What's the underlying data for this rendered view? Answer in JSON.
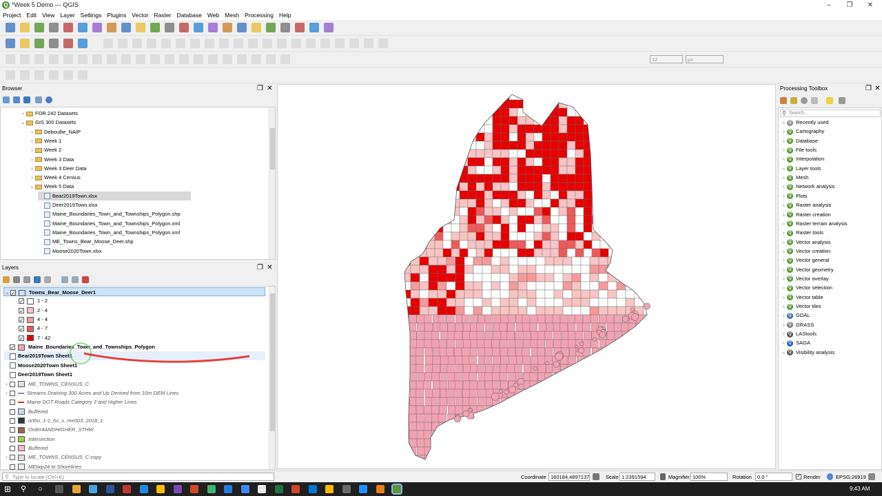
{
  "window": {
    "title": "*Week 5 Demo — QGIS"
  },
  "menu": [
    "Project",
    "Edit",
    "View",
    "Layer",
    "Settings",
    "Plugins",
    "Vector",
    "Raster",
    "Database",
    "Web",
    "Mesh",
    "Processing",
    "Help"
  ],
  "browser": {
    "title": "Browser",
    "items": [
      {
        "label": "FOR 242 Datasets",
        "arrow": "›",
        "indent": 0,
        "type": "folder"
      },
      {
        "label": "GIS 300 Datasets",
        "arrow": "⌄",
        "indent": 0,
        "type": "folder"
      },
      {
        "label": "Deboullie_NAIP",
        "arrow": "›",
        "indent": 1,
        "type": "folder"
      },
      {
        "label": "Week 1",
        "arrow": "›",
        "indent": 1,
        "type": "folder"
      },
      {
        "label": "Week 2",
        "arrow": "›",
        "indent": 1,
        "type": "folder"
      },
      {
        "label": "Week 3 Data",
        "arrow": "›",
        "indent": 1,
        "type": "folder"
      },
      {
        "label": "Week 3 Deer Data",
        "arrow": "›",
        "indent": 1,
        "type": "folder"
      },
      {
        "label": "Week 4 Census",
        "arrow": "›",
        "indent": 1,
        "type": "folder"
      },
      {
        "label": "Week 5 Data",
        "arrow": "⌄",
        "indent": 1,
        "type": "folder"
      },
      {
        "label": "Bear2019Town.xlsx",
        "arrow": "",
        "indent": 2,
        "type": "file",
        "selected": true
      },
      {
        "label": "Deer2019Town.xlsx",
        "arrow": "",
        "indent": 2,
        "type": "file"
      },
      {
        "label": "Maine_Boundaries_Town_and_Townships_Polygon.shp",
        "arrow": "",
        "indent": 2,
        "type": "file"
      },
      {
        "label": "Maine_Boundaries_Town_and_Townships_Polygon.xml",
        "arrow": "",
        "indent": 2,
        "type": "file"
      },
      {
        "label": "Maine_Boundaries_Town_and_Townships_Polygon.xml",
        "arrow": "",
        "indent": 2,
        "type": "file"
      },
      {
        "label": "ME_Towns_Bear_Moose_Deer.shp",
        "arrow": "",
        "indent": 2,
        "type": "file"
      },
      {
        "label": "Moose2020Town.xlsx",
        "arrow": "",
        "indent": 2,
        "type": "file"
      }
    ]
  },
  "layers": {
    "title": "Layers",
    "items": [
      {
        "label": "Towns_Bear_Moose_Deer1",
        "checked": true,
        "bold": true,
        "indent": 0,
        "arrow": "⌄",
        "selected": true,
        "swatch": "#cfe0f5"
      },
      {
        "label": "1 - 2",
        "checked": true,
        "indent": 1,
        "swatch": "#ffffff"
      },
      {
        "label": "2 - 4",
        "checked": true,
        "indent": 1,
        "swatch": "#f8c4c4"
      },
      {
        "label": "4 - 4",
        "checked": true,
        "indent": 1,
        "swatch": "#f49a9a"
      },
      {
        "label": "4 - 7",
        "checked": true,
        "indent": 1,
        "swatch": "#ee5a5a"
      },
      {
        "label": "7 - 42",
        "checked": true,
        "indent": 1,
        "swatch": "#e60000"
      },
      {
        "label": "Maine_Boundaries_Town_and_Townships_Polygon",
        "checked": true,
        "bold": true,
        "indent": 0,
        "swatch": "#f2a3b3"
      },
      {
        "label": "Bear2019Town Sheet1",
        "checked": null,
        "bold": true,
        "indent": 0,
        "table": true,
        "hover": true
      },
      {
        "label": "Moose2020Town Sheet1",
        "checked": null,
        "bold": true,
        "indent": 0,
        "table": true
      },
      {
        "label": "Deer2019Town Sheet1",
        "checked": null,
        "bold": true,
        "indent": 0,
        "table": true
      },
      {
        "label": "ME_TOWNS_CENSUS_C",
        "checked": false,
        "italic": true,
        "indent": 0,
        "arrow": "›",
        "swatch": "#e0e0e0"
      },
      {
        "label": "Streams Draining 300 Acres and Up Derived from 10m DEM Lines",
        "checked": false,
        "italic": true,
        "indent": 0,
        "arrow": "›",
        "line": "#88a"
      },
      {
        "label": "Maine DOT Roads Category 3 and Higher Lines",
        "checked": false,
        "italic": true,
        "indent": 0,
        "line": "#c33"
      },
      {
        "label": "Buffered",
        "checked": false,
        "italic": true,
        "indent": 0,
        "swatch": "#c8d8f0"
      },
      {
        "label": "ortho_1-1_hc_s_me003_2018_1",
        "checked": false,
        "italic": true,
        "indent": 0,
        "swatch": "#334"
      },
      {
        "label": "Order4ANDHIGHER_STHW",
        "checked": false,
        "italic": true,
        "indent": 0,
        "swatch": "#a06048"
      },
      {
        "label": "Intersection",
        "checked": false,
        "italic": true,
        "indent": 0,
        "swatch": "#a8c850"
      },
      {
        "label": "Buffered",
        "checked": false,
        "italic": true,
        "indent": 0,
        "swatch": "#f5b8c8"
      },
      {
        "label": "ME_TOWNS_CENSUS_C copy",
        "checked": false,
        "italic": true,
        "indent": 0,
        "arrow": "›",
        "swatch": "#e0e0e0"
      },
      {
        "label": "MEtwp24 to Shorelines",
        "checked": false,
        "italic": true,
        "indent": 0,
        "swatch": "#eee"
      }
    ]
  },
  "locator": {
    "placeholder": "Type to locate (Ctrl+K)"
  },
  "processing": {
    "title": "Processing Toolbox",
    "search_placeholder": "Search...",
    "items": [
      "Recently used",
      "Cartography",
      "Database",
      "File tools",
      "Interpolation",
      "Layer tools",
      "Mesh",
      "Network analysis",
      "Plots",
      "Raster analysis",
      "Raster creation",
      "Raster terrain analysis",
      "Raster tools",
      "Vector analysis",
      "Vector creation",
      "Vector general",
      "Vector geometry",
      "Vector overlay",
      "Vector selection",
      "Vector table",
      "Vector tiles",
      "GDAL",
      "GRASS",
      "LAStools",
      "SAGA",
      "Visibility analysis"
    ]
  },
  "status": {
    "coordinate_label": "Coordinate",
    "coordinate": "160184,4897137",
    "scale_label": "Scale",
    "scale": "1:2391594",
    "magnifier_label": "Magnifier",
    "magnifier": "100%",
    "rotation_label": "Rotation",
    "rotation": "0.0 °",
    "render_label": "Render",
    "crs": "EPSG:26919"
  },
  "snapping": {
    "tolerance": "12",
    "unit": "px"
  },
  "taskbar": {
    "time": "9:43 AM"
  },
  "colors": {
    "class1": "#ffffff",
    "class2": "#f8c4c4",
    "class3": "#f49a9a",
    "class4": "#ee5a5a",
    "class5": "#e60000",
    "base": "#f2a3b3"
  }
}
